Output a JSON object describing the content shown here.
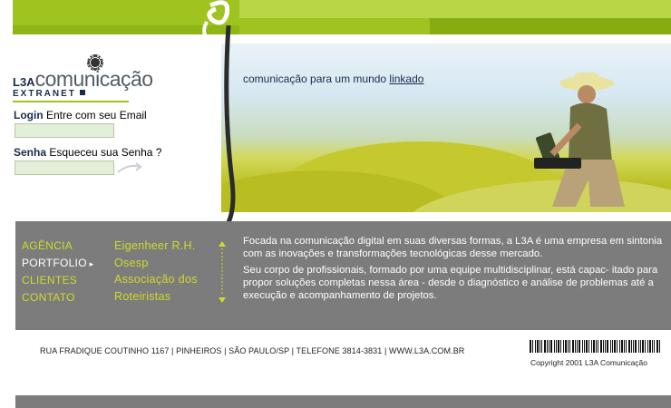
{
  "brand": {
    "logo_l3a": "L3A",
    "logo_rest": "comunicação",
    "extranet": "EXTRANET"
  },
  "login": {
    "label_bold": "Login",
    "label_rest": " Entre com seu Email",
    "value": ""
  },
  "senha": {
    "label_bold": "Senha",
    "label_rest": " Esqueceu sua Senha ?",
    "value": ""
  },
  "hero": {
    "tagline_prefix": "comunicação para um mundo ",
    "tagline_link": "linkado"
  },
  "nav": {
    "items": [
      {
        "label": "AGÊNCIA"
      },
      {
        "label": "PORTFOLIO"
      },
      {
        "label": "CLIENTES"
      },
      {
        "label": "CONTATO"
      }
    ]
  },
  "portfolio": {
    "items": [
      {
        "label": "Eigenheer R.H."
      },
      {
        "label": "Osesp"
      },
      {
        "label": "Associação dos"
      },
      {
        "label": "Roteiristas"
      }
    ]
  },
  "description": {
    "p1": "Focada na comunicação digital em suas diversas formas, a L3A é uma empresa em sintonia com as inovações e transformações tecnológicas desse mercado.",
    "p2": "Seu corpo de profissionais, formado por uma equipe multidisciplinar, está capac- itado para propor soluções completas nessa área - desde o diagnóstico e análise de problemas até a execução e acompanhamento de projetos."
  },
  "footer": {
    "address": "RUA FRADIQUE COUTINHO 1167  |  PINHEIROS  |  SÃO PAULO/SP  |  TELEFONE 3814-3831  |  WWW.L3A.COM.BR",
    "copyright": "Copyright 2001 L3A Comunicação"
  },
  "colors": {
    "accent_green": "#9fc31f",
    "nav_green": "#cddc2a",
    "panel_grey": "#7c7c7c",
    "navy": "#1b2c4c"
  }
}
